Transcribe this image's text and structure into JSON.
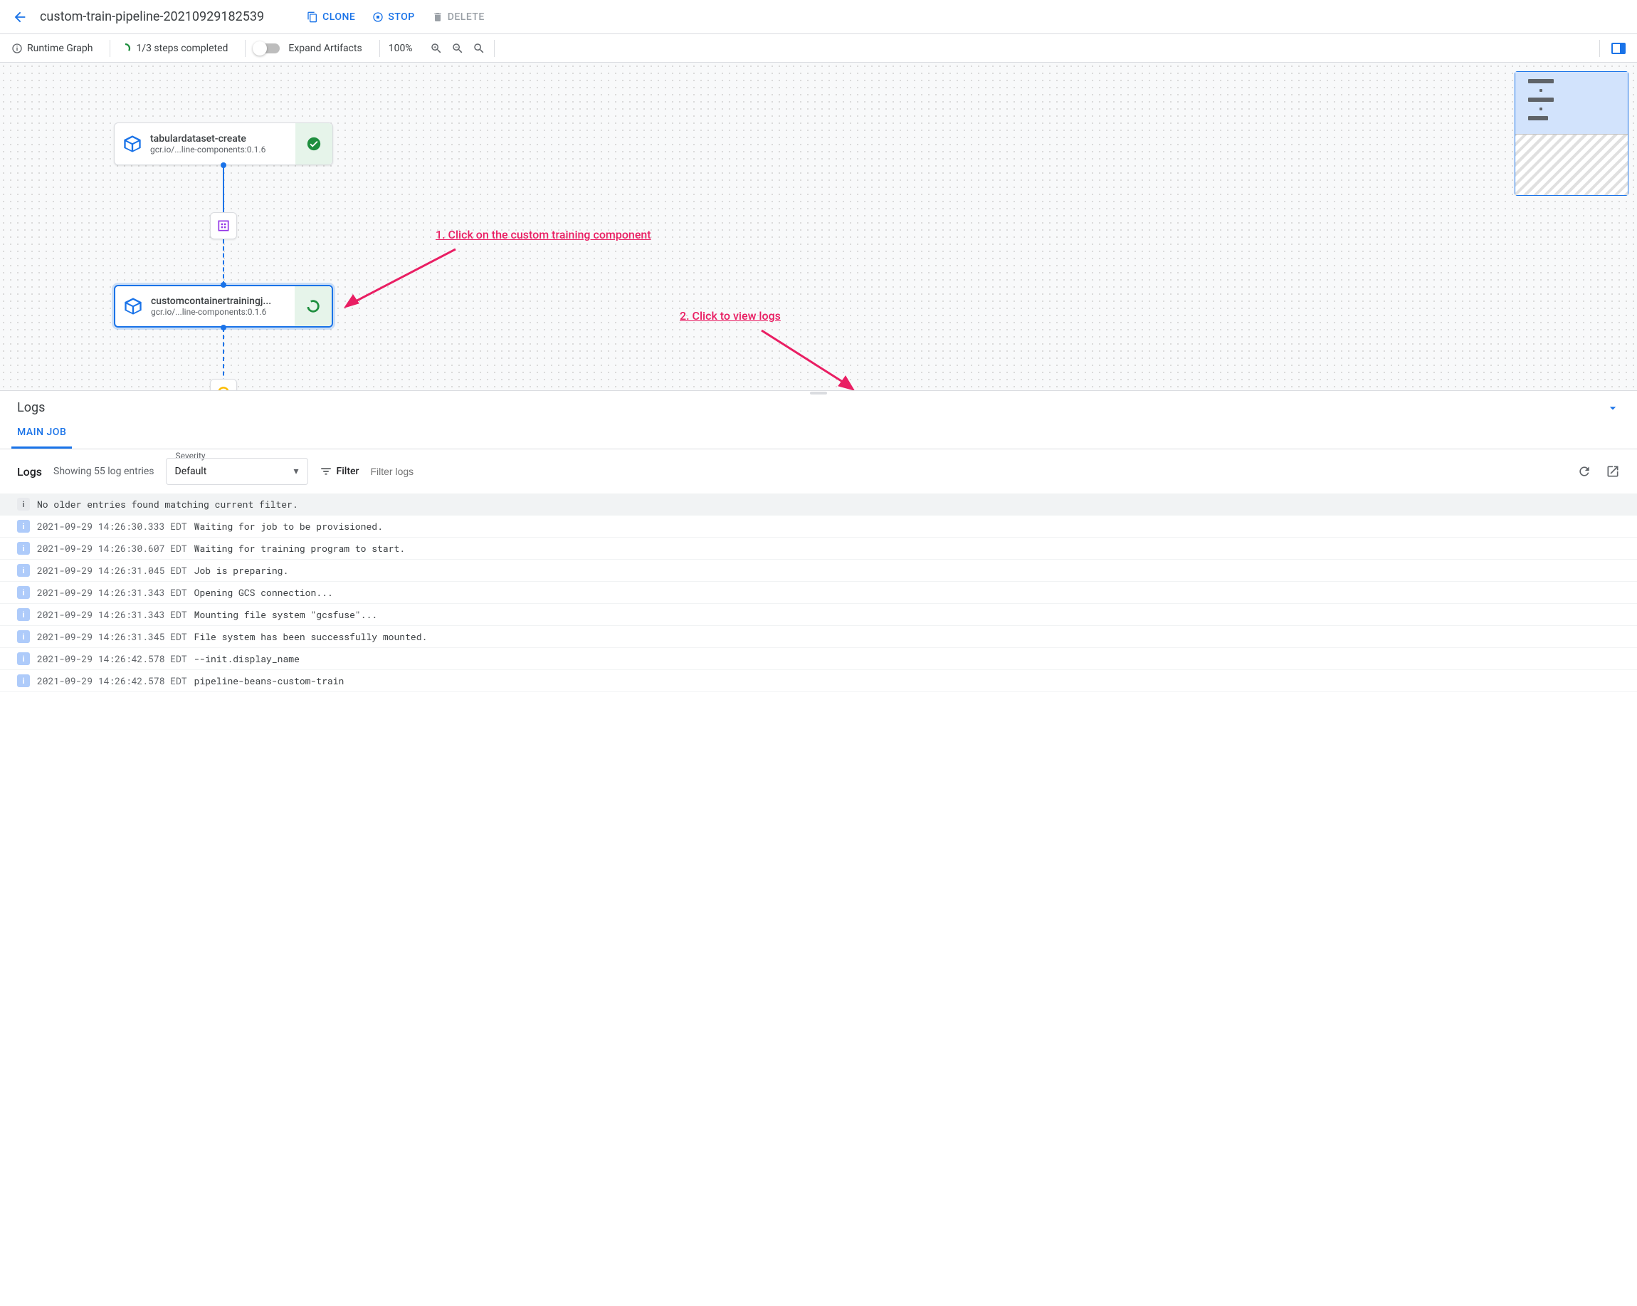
{
  "header": {
    "title": "custom-train-pipeline-20210929182539",
    "clone": "CLONE",
    "stop": "STOP",
    "delete": "DELETE"
  },
  "toolbar": {
    "runtime_graph": "Runtime Graph",
    "steps_completed": "1/3 steps completed",
    "expand_artifacts": "Expand Artifacts",
    "zoom": "100%"
  },
  "nodes": {
    "node1": {
      "title": "tabulardataset-create",
      "subtitle": "gcr.io/...line-components:0.1.6"
    },
    "node2": {
      "title": "customcontainertrainingj...",
      "subtitle": "gcr.io/...line-components:0.1.6"
    }
  },
  "annotations": {
    "a1": "1. Click on the custom training component",
    "a2": "2. Click to view logs"
  },
  "logs": {
    "title": "Logs",
    "tab": "MAIN JOB",
    "count_label": "Logs",
    "count_text": "Showing 55 log entries",
    "severity_label": "Severity",
    "severity_value": "Default",
    "filter_label": "Filter",
    "filter_placeholder": "Filter logs",
    "notice": "No older entries found matching current filter.",
    "entries": [
      {
        "ts": "2021-09-29 14:26:30.333 EDT",
        "msg": "Waiting for job to be provisioned."
      },
      {
        "ts": "2021-09-29 14:26:30.607 EDT",
        "msg": "Waiting for training program to start."
      },
      {
        "ts": "2021-09-29 14:26:31.045 EDT",
        "msg": "Job is preparing."
      },
      {
        "ts": "2021-09-29 14:26:31.343 EDT",
        "msg": "Opening GCS connection..."
      },
      {
        "ts": "2021-09-29 14:26:31.343 EDT",
        "msg": "Mounting file system \"gcsfuse\"..."
      },
      {
        "ts": "2021-09-29 14:26:31.345 EDT",
        "msg": "File system has been successfully mounted."
      },
      {
        "ts": "2021-09-29 14:26:42.578 EDT",
        "msg": "--init.display_name"
      },
      {
        "ts": "2021-09-29 14:26:42.578 EDT",
        "msg": "pipeline-beans-custom-train"
      }
    ]
  }
}
